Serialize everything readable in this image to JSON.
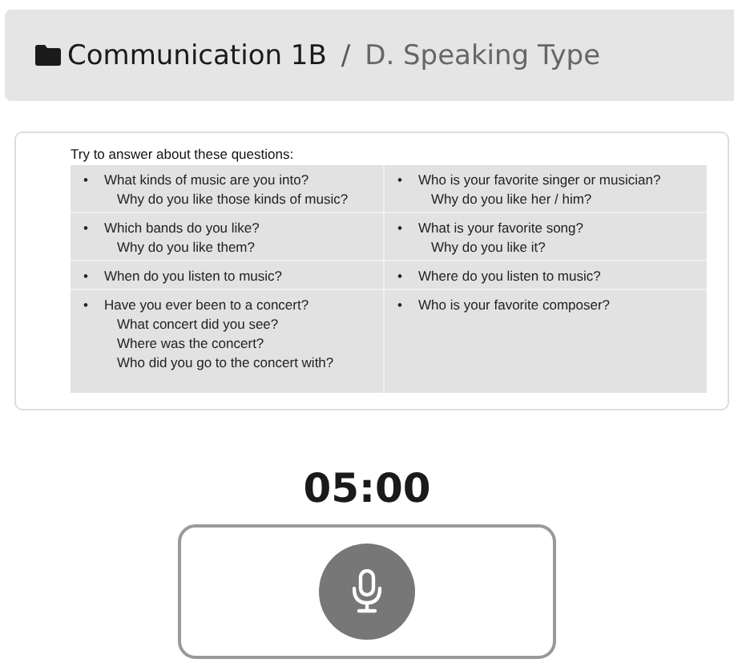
{
  "breadcrumb": {
    "course": "Communication 1B",
    "separator": "/",
    "section": "D. Speaking Type"
  },
  "slide": {
    "title": "Try to answer about these questions:",
    "rows": [
      {
        "cells": [
          {
            "bullet": "•",
            "lines": [
              "What kinds of music are you into?",
              "Why do you like those kinds of music?"
            ]
          },
          {
            "bullet": "•",
            "lines": [
              "Who is your favorite singer or musician?",
              "Why do you like her / him?"
            ]
          }
        ]
      },
      {
        "cells": [
          {
            "bullet": "•",
            "lines": [
              "Which bands do you like?",
              "Why do you like them?"
            ]
          },
          {
            "bullet": "•",
            "lines": [
              "What is your favorite song?",
              "Why do you like it?"
            ]
          }
        ]
      },
      {
        "cells": [
          {
            "bullet": "•",
            "lines": [
              "When do you listen to music?"
            ]
          },
          {
            "bullet": "•",
            "lines": [
              "Where do you listen to music?"
            ]
          }
        ]
      },
      {
        "cells": [
          {
            "bullet": "•",
            "lines": [
              "Have you ever been to a concert?",
              "What concert did you see?",
              "Where was the concert?",
              "Who did you go to the concert with?"
            ]
          },
          {
            "bullet": "•",
            "lines": [
              "Who is your favorite composer?"
            ]
          }
        ]
      }
    ]
  },
  "timer": "05:00"
}
